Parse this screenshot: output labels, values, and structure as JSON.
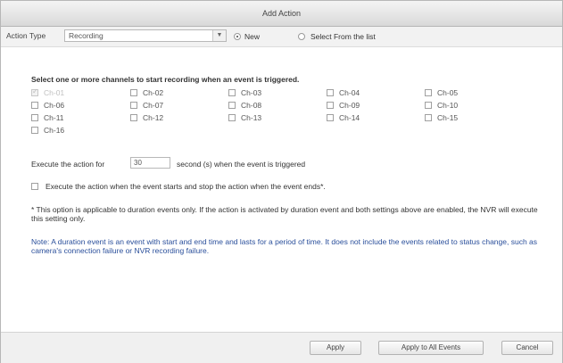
{
  "window": {
    "title": "Add Action"
  },
  "toolbar": {
    "action_type_label": "Action Type",
    "action_type_value": "Recording",
    "new_label": "New",
    "select_list_label": "Select From the list",
    "mode": "new"
  },
  "main": {
    "heading": "Select one or more channels to start recording when an event is triggered.",
    "channels": [
      {
        "label": "Ch-01",
        "checked": true,
        "disabled": true
      },
      {
        "label": "Ch-02",
        "checked": false
      },
      {
        "label": "Ch-03",
        "checked": false
      },
      {
        "label": "Ch-04",
        "checked": false
      },
      {
        "label": "Ch-05",
        "checked": false
      },
      {
        "label": "Ch-06",
        "checked": false
      },
      {
        "label": "Ch-07",
        "checked": false
      },
      {
        "label": "Ch-08",
        "checked": false
      },
      {
        "label": "Ch-09",
        "checked": false
      },
      {
        "label": "Ch-10",
        "checked": false
      },
      {
        "label": "Ch-11",
        "checked": false
      },
      {
        "label": "Ch-12",
        "checked": false
      },
      {
        "label": "Ch-13",
        "checked": false
      },
      {
        "label": "Ch-14",
        "checked": false
      },
      {
        "label": "Ch-15",
        "checked": false
      },
      {
        "label": "Ch-16",
        "checked": false
      }
    ],
    "execute_prefix": "Execute the action for",
    "execute_value": "30",
    "execute_suffix": "second (s) when the event is triggered",
    "start_stop_label": "Execute the action when the event starts and stop the action when the event ends*.",
    "footnote": "* This option is applicable to duration events only. If the action is activated by duration event and both settings above are enabled, the NVR will execute this setting only.",
    "note": "Note: A duration event is an event with start and end time and lasts for a period of time. It does not include the events related to status change, such as camera's connection failure or NVR recording failure."
  },
  "footer": {
    "apply_label": "Apply",
    "apply_all_label": "Apply to All Events",
    "cancel_label": "Cancel"
  },
  "colors": {
    "note_text": "#2a4f9b",
    "titlebar_bg": "#d9d9d9",
    "footer_bg": "#f0f0f0"
  }
}
